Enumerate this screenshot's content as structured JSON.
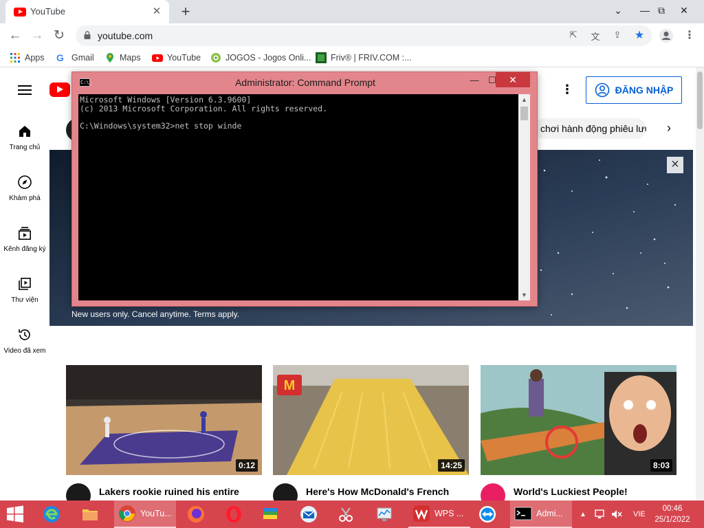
{
  "browser": {
    "tab_title": "YouTube",
    "tab_close": "✕",
    "new_tab": "+",
    "url": "youtube.com",
    "window_controls": {
      "minimize": "⌄",
      "restore": "⧉",
      "close": "✕",
      "dash": "—"
    }
  },
  "bookmarks": [
    {
      "label": "Apps",
      "icon": "apps-grid-icon"
    },
    {
      "label": "Gmail",
      "icon": "google-icon"
    },
    {
      "label": "Maps",
      "icon": "maps-pin-icon"
    },
    {
      "label": "YouTube",
      "icon": "youtube-icon"
    },
    {
      "label": "JOGOS - Jogos Onli...",
      "icon": "jogos-icon"
    },
    {
      "label": "Friv® | FRIV.COM :...",
      "icon": "friv-icon"
    }
  ],
  "youtube": {
    "signin_label": "ĐĂNG NHẬP",
    "chip_label": "chơi hành động phiêu lưu",
    "banner_note": "New users only. Cancel anytime. Terms apply.",
    "sidebar": [
      {
        "label": "Trang chủ",
        "icon": "home-icon"
      },
      {
        "label": "Khám phá",
        "icon": "explore-compass-icon"
      },
      {
        "label": "Kênh đăng ký",
        "icon": "subscriptions-icon"
      },
      {
        "label": "Thư viện",
        "icon": "library-icon"
      },
      {
        "label": "Video đã xem",
        "icon": "history-icon"
      }
    ],
    "videos": [
      {
        "title": "Lakers rookie ruined his entire",
        "duration": "0:12"
      },
      {
        "title": "Here's How McDonald's French",
        "duration": "14:25"
      },
      {
        "title": "World's Luckiest People!",
        "duration": "8:03"
      }
    ]
  },
  "cmd": {
    "title": "Administrator: Command Prompt",
    "icon_text": "C:\\_",
    "lines": [
      "Microsoft Windows [Version 6.3.9600]",
      "(c) 2013 Microsoft Corporation. All rights reserved.",
      "",
      "C:\\Windows\\system32>net stop winde"
    ],
    "minimize": "—",
    "maximize": "☐",
    "close": "✕"
  },
  "taskbar": {
    "items": [
      {
        "label": "YouTu...",
        "icon": "chrome-icon"
      },
      {
        "label": "WPS ...",
        "icon": "wps-office-icon"
      },
      {
        "label": "Admi...",
        "icon": "cmd-icon"
      }
    ],
    "lang": "VIE",
    "time": "00:46",
    "date": "25/1/2022"
  },
  "colors": {
    "taskbar": "#d6454e",
    "cmd_frame": "#e3868c",
    "youtube_red": "#ff0000",
    "signin_blue": "#065fd4"
  }
}
